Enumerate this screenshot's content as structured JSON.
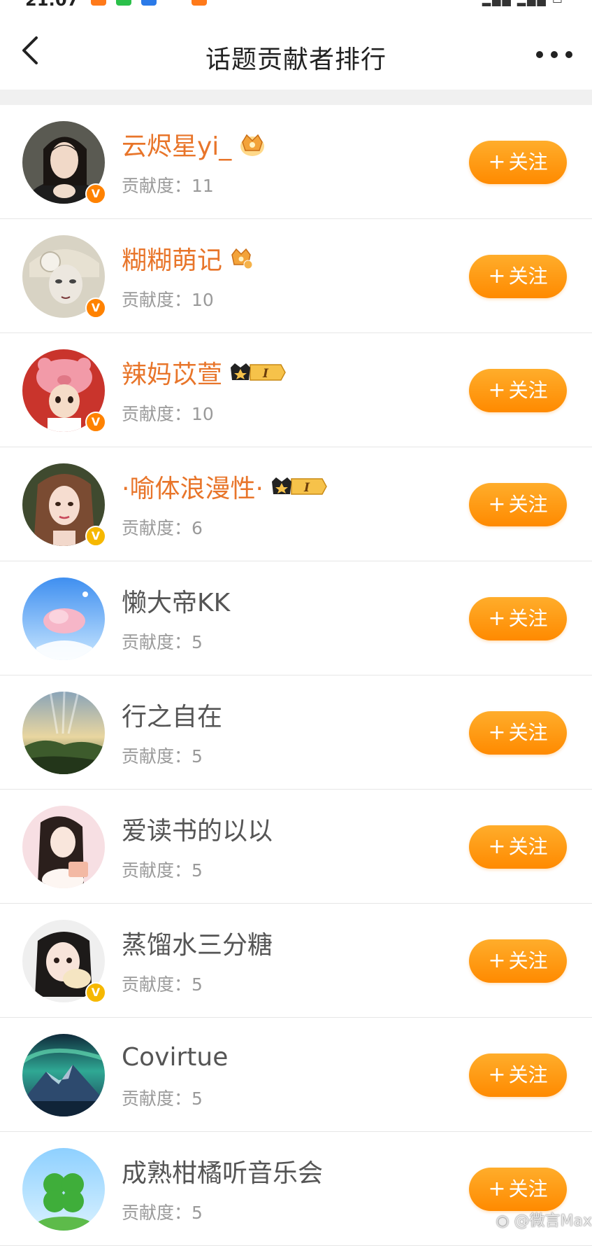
{
  "status_bar": {
    "time": "21:07"
  },
  "header": {
    "title": "话题贡献者排行"
  },
  "contrib_label": "贡献度：",
  "follow_label": "关注",
  "level_badge": "I",
  "watermark": "@微言Max",
  "colors": {
    "accent": "#ff8a00",
    "vip_name": "#e8752a",
    "verified_badge": "#ff8200",
    "verified_gold": "#f6b800"
  },
  "users": [
    {
      "name": "云烬星yi_",
      "score": "11",
      "vip": true,
      "badge": "crown-large",
      "verified": "orange"
    },
    {
      "name": "糊糊萌记",
      "score": "10",
      "vip": true,
      "badge": "crown-small",
      "verified": "orange"
    },
    {
      "name": "辣妈苡萱",
      "score": "10",
      "vip": true,
      "badge": "level",
      "verified": "orange"
    },
    {
      "name": "·喻体浪漫性·",
      "score": "6",
      "vip": true,
      "badge": "level",
      "verified": "gold"
    },
    {
      "name": "懒大帝KK",
      "score": "5",
      "vip": false,
      "badge": "",
      "verified": ""
    },
    {
      "name": "行之自在",
      "score": "5",
      "vip": false,
      "badge": "",
      "verified": ""
    },
    {
      "name": "爱读书的以以",
      "score": "5",
      "vip": false,
      "badge": "",
      "verified": ""
    },
    {
      "name": "蒸馏水三分糖",
      "score": "5",
      "vip": false,
      "badge": "",
      "verified": "gold"
    },
    {
      "name": "Covirtue",
      "score": "5",
      "vip": false,
      "badge": "",
      "verified": ""
    },
    {
      "name": "成熟柑橘听音乐会",
      "score": "5",
      "vip": false,
      "badge": "",
      "verified": ""
    }
  ]
}
